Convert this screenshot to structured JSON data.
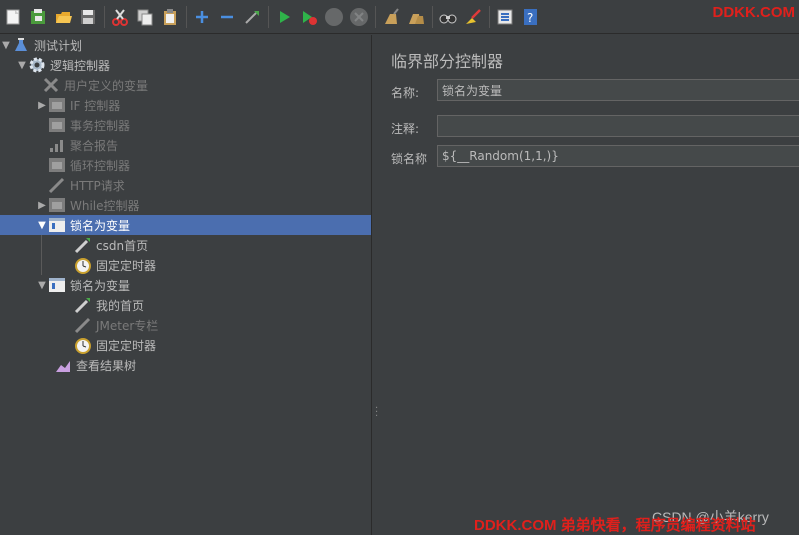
{
  "brand": "DDKK.COM",
  "toolbar": {
    "buttons": [
      "new-icon",
      "templates-icon",
      "open-icon",
      "save-icon",
      "cut-icon",
      "copy-icon",
      "paste-icon",
      "expand-icon",
      "collapse-icon",
      "toggle-icon",
      "start-icon",
      "start-no-pause-icon",
      "stop-icon",
      "shutdown-icon",
      "clear-icon",
      "clear-all-icon",
      "search-icon",
      "reset-search-icon",
      "function-helper-icon",
      "help-icon"
    ]
  },
  "tree": {
    "items": [
      {
        "label": "测试计划",
        "icon": "test-plan-icon",
        "disabled": false
      },
      {
        "label": "逻辑控制器",
        "icon": "gear-icon",
        "disabled": false
      },
      {
        "label": "用户定义的变量",
        "icon": "config-wrench-icon",
        "disabled": true
      },
      {
        "label": "IF 控制器",
        "icon": "controller-icon",
        "disabled": true
      },
      {
        "label": "事务控制器",
        "icon": "controller-icon",
        "disabled": true
      },
      {
        "label": "聚合报告",
        "icon": "report-icon",
        "disabled": true
      },
      {
        "label": "循环控制器",
        "icon": "controller-icon",
        "disabled": true
      },
      {
        "label": "HTTP请求",
        "icon": "sampler-icon",
        "disabled": true
      },
      {
        "label": "While控制器",
        "icon": "controller-icon",
        "disabled": true
      },
      {
        "label": "锁名为变量",
        "icon": "controller-icon",
        "disabled": false
      },
      {
        "label": "csdn首页",
        "icon": "sampler-icon",
        "disabled": false
      },
      {
        "label": "固定定时器",
        "icon": "timer-icon",
        "disabled": false
      },
      {
        "label": "锁名为变量",
        "icon": "controller-icon",
        "disabled": false
      },
      {
        "label": "我的首页",
        "icon": "sampler-icon",
        "disabled": false
      },
      {
        "label": "JMeter专栏",
        "icon": "sampler-icon",
        "disabled": true
      },
      {
        "label": "固定定时器",
        "icon": "timer-icon",
        "disabled": false
      },
      {
        "label": "查看结果树",
        "icon": "listener-icon",
        "disabled": false
      }
    ]
  },
  "panel": {
    "title": "临界部分控制器",
    "name_label": "名称:",
    "name_value": "锁名为变量",
    "comment_label": "注释:",
    "comment_value": "",
    "lock_label": "锁名称",
    "lock_value": "${__Random(1,1,)}"
  },
  "watermarks": {
    "csdn": "CSDN @小羊kerry",
    "site": "DDKK.COM 弟弟快看，程序员编程资料站"
  },
  "colors": {
    "background": "#3c3f41",
    "selection": "#4b6eaf",
    "brand_red": "#e0201c"
  }
}
